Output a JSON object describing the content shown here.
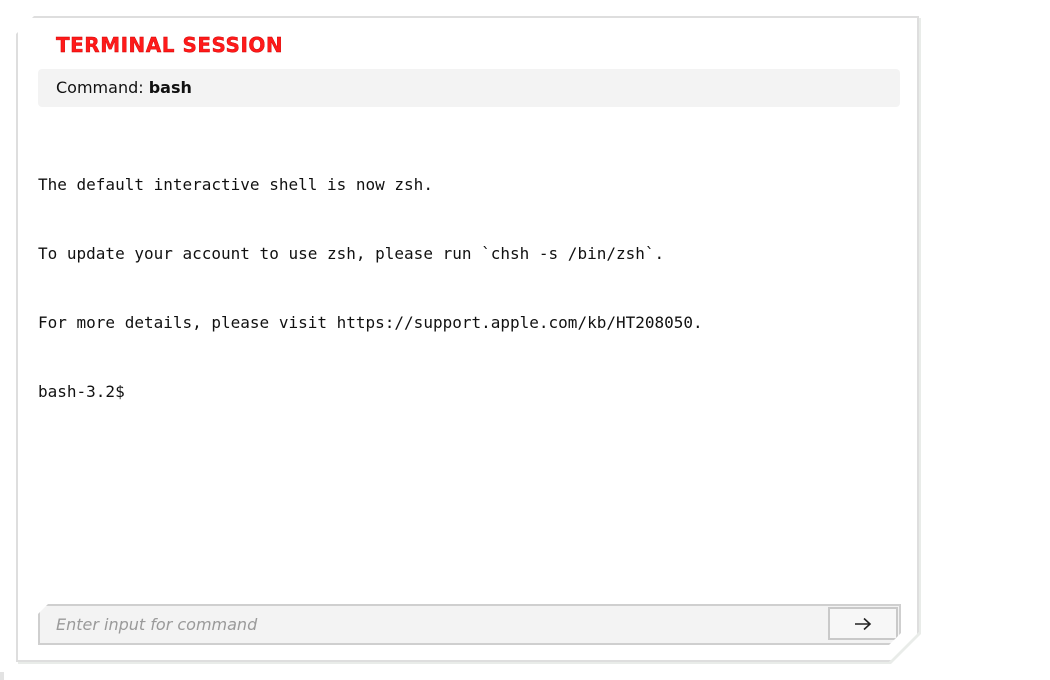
{
  "window": {
    "title": "TERMINAL SESSION"
  },
  "command_bar": {
    "label": "Command:",
    "value": "bash"
  },
  "output": {
    "lines": [
      "The default interactive shell is now zsh.",
      "To update your account to use zsh, please run `chsh -s /bin/zsh`.",
      "For more details, please visit https://support.apple.com/kb/HT208050.",
      "bash-3.2$"
    ]
  },
  "input": {
    "value": "",
    "placeholder": "Enter input for command"
  },
  "submit_button": {
    "icon": "arrow-right-icon"
  },
  "colors": {
    "title": "#ff1a1a",
    "panel_border": "#dedede",
    "bar_background": "#f3f3f3"
  }
}
